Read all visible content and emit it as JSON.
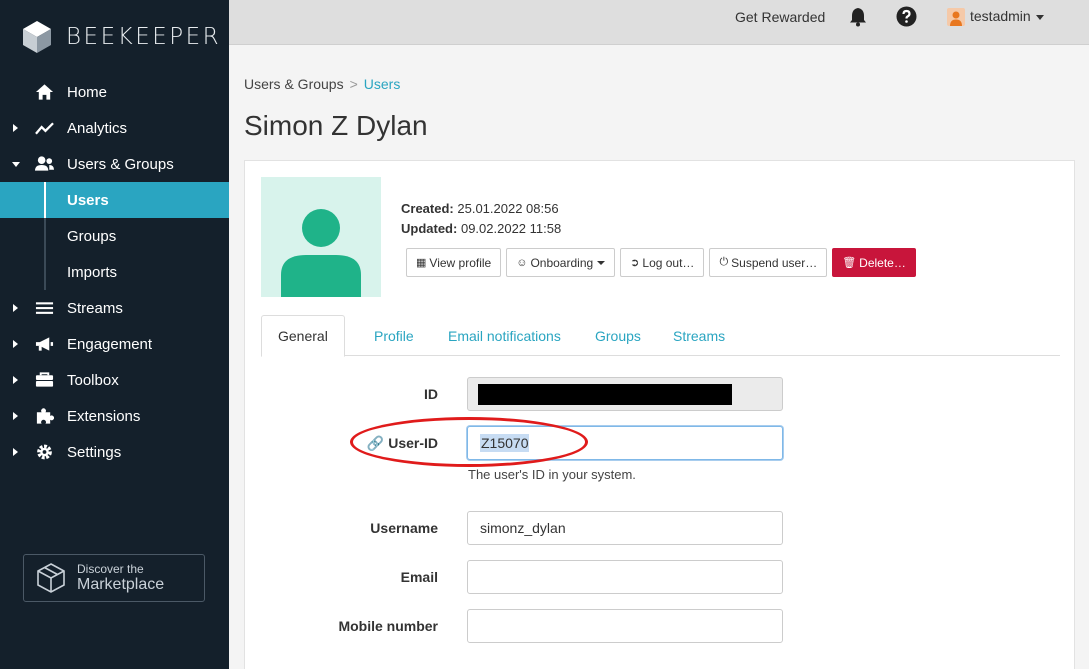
{
  "brand": {
    "name": "BEEKEEPER"
  },
  "sidebar": {
    "items": [
      {
        "label": "Home",
        "icon": "home-icon"
      },
      {
        "label": "Analytics",
        "icon": "analytics-icon"
      },
      {
        "label": "Users & Groups",
        "icon": "users-icon",
        "expanded": true,
        "children": [
          {
            "label": "Users",
            "active": true
          },
          {
            "label": "Groups"
          },
          {
            "label": "Imports"
          }
        ]
      },
      {
        "label": "Streams",
        "icon": "streams-icon"
      },
      {
        "label": "Engagement",
        "icon": "megaphone-icon"
      },
      {
        "label": "Toolbox",
        "icon": "toolbox-icon"
      },
      {
        "label": "Extensions",
        "icon": "puzzle-icon"
      },
      {
        "label": "Settings",
        "icon": "gear-icon"
      }
    ],
    "marketplace": {
      "small": "Discover the",
      "big": "Marketplace"
    }
  },
  "topbar": {
    "rewarded": "Get Rewarded",
    "user": "testadmin"
  },
  "breadcrumb": {
    "parent": "Users & Groups",
    "separator": ">",
    "current": "Users"
  },
  "page": {
    "title": "Simon Z Dylan"
  },
  "profile": {
    "created_label": "Created:",
    "created_value": "25.01.2022 08:56",
    "updated_label": "Updated:",
    "updated_value": "09.02.2022 11:58"
  },
  "actions": {
    "view_profile": "View profile",
    "onboarding": "Onboarding",
    "logout": "Log out…",
    "suspend": "Suspend user…",
    "delete": "Delete…"
  },
  "tabs": [
    "General",
    "Profile",
    "Email notifications",
    "Groups",
    "Streams"
  ],
  "form": {
    "id_label": "ID",
    "userid_label": "User-ID",
    "userid_value": "Z15070",
    "userid_help": "The user's ID in your system.",
    "username_label": "Username",
    "username_value": "simonz_dylan",
    "email_label": "Email",
    "email_value": "",
    "mobile_label": "Mobile number",
    "mobile_value": ""
  },
  "colors": {
    "sidebar_bg": "#14202b",
    "accent": "#2aa5c1",
    "danger": "#c8153b",
    "highlight_ellipse": "#e01b1b",
    "avatar_green": "#1fb389"
  }
}
